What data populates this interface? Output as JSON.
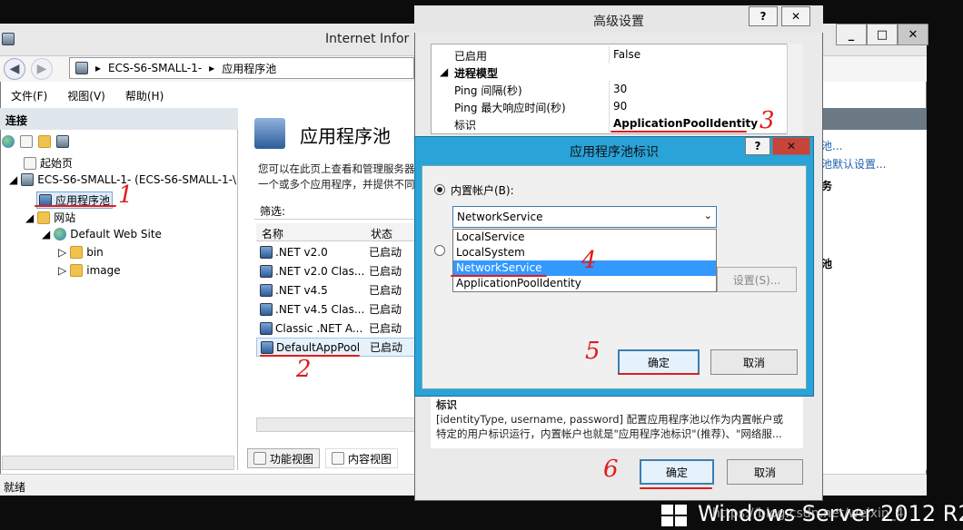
{
  "iis": {
    "title": "Internet Infor",
    "address": [
      "ECS-S6-SMALL-1-",
      "应用程序池"
    ],
    "menu": [
      "文件(F)",
      "视图(V)",
      "帮助(H)"
    ],
    "connections_label": "连接",
    "tree": {
      "start_page": "起始页",
      "server": "ECS-S6-SMALL-1- (ECS-S6-SMALL-1-\\",
      "app_pools": "应用程序池",
      "sites": "网站",
      "default_site": "Default Web Site",
      "folder_bin": "bin",
      "folder_image": "image"
    },
    "center": {
      "title": "应用程序池",
      "desc_line1": "您可以在此页上查看和管理服务器",
      "desc_line2": "一个或多个应用程序，并提供不同",
      "filter_label": "筛选:",
      "col_name": "名称",
      "col_status": "状态",
      "rows": [
        {
          "name": ".NET v2.0",
          "status": "已启动"
        },
        {
          "name": ".NET v2.0 Clas...",
          "status": "已启动"
        },
        {
          "name": ".NET v4.5",
          "status": "已启动"
        },
        {
          "name": ".NET v4.5 Clas...",
          "status": "已启动"
        },
        {
          "name": "Classic .NET A...",
          "status": "已启动"
        },
        {
          "name": "DefaultAppPool",
          "status": "已启动"
        }
      ],
      "tab_features": "功能视图",
      "tab_content": "内容视图"
    },
    "right": {
      "link1": "池...",
      "link2": "池默认设置...",
      "section1": "务",
      "section2": "池"
    },
    "status": "就绪"
  },
  "advanced": {
    "title": "高级设置",
    "help_btn": "?",
    "close_btn": "✕",
    "props": [
      {
        "key": "已启用",
        "value": "False"
      },
      {
        "key": "进程模型",
        "value": ""
      },
      {
        "key": "Ping 间隔(秒)",
        "value": "30"
      },
      {
        "key": "Ping 最大响应时间(秒)",
        "value": "90"
      },
      {
        "key": "标识",
        "value": "ApplicationPoolIdentity"
      }
    ],
    "desc_title": "标识",
    "desc_line1": "[identityType, username, password] 配置应用程序池以作为内置帐户或",
    "desc_line2": "特定的用户标识运行，内置帐户也就是\"应用程序池标识\"(推荐)、\"网络服...",
    "ok": "确定",
    "cancel": "取消"
  },
  "identity": {
    "title": "应用程序池标识",
    "help_btn": "?",
    "close_btn": "✕",
    "builtin_label": "内置帐户(B):",
    "selected": "NetworkService",
    "options": [
      "LocalService",
      "LocalSystem",
      "NetworkService",
      "ApplicationPoolIdentity"
    ],
    "settings_btn": "设置(S)...",
    "ok": "确定",
    "cancel": "取消"
  },
  "annotations": [
    "1",
    "2",
    "3",
    "4",
    "5",
    "6"
  ],
  "watermark": {
    "product": "Windows Server 2012 R2",
    "url": "https://blog.csdn.net/weixin_4"
  },
  "colors": {
    "accent": "#29a3d8",
    "annotation": "#e01d1d",
    "selection": "#3399ff"
  }
}
